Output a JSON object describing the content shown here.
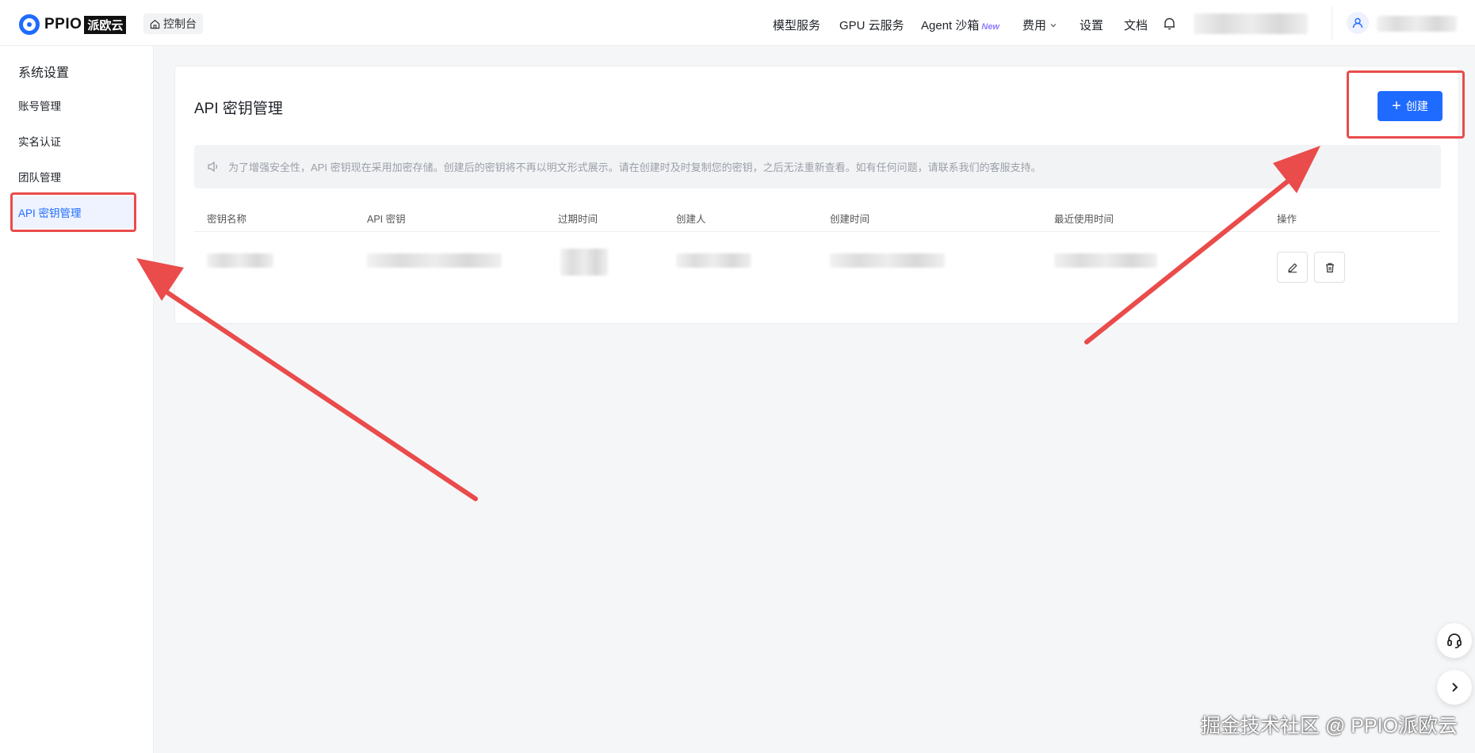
{
  "brand": {
    "name": "PPIO",
    "name_cn": "派欧云"
  },
  "header": {
    "console_label": "控制台",
    "nav": [
      {
        "label": "模型服务"
      },
      {
        "label": "GPU 云服务"
      },
      {
        "label": "Agent 沙箱",
        "badge": "New"
      },
      {
        "label": "费用"
      },
      {
        "label": "设置"
      },
      {
        "label": "文档"
      }
    ]
  },
  "sidebar": {
    "title": "系统设置",
    "items": [
      {
        "label": "账号管理"
      },
      {
        "label": "实名认证"
      },
      {
        "label": "团队管理"
      },
      {
        "label": "API 密钥管理",
        "active": true
      }
    ]
  },
  "main": {
    "title": "API 密钥管理",
    "create_label": "创建",
    "notice": "为了增强安全性，API 密钥现在采用加密存储。创建后的密钥将不再以明文形式展示。请在创建时及时复制您的密钥，之后无法重新查看。如有任何问题，请联系我们的客服支持。",
    "columns": [
      "密钥名称",
      "API 密钥",
      "过期时间",
      "创建人",
      "创建时间",
      "最近使用时间",
      "操作"
    ]
  },
  "watermark": "掘金技术社区 @ PPIO派欧云",
  "colors": {
    "accent": "#1f6bff",
    "annotation": "#ea4b4b"
  }
}
